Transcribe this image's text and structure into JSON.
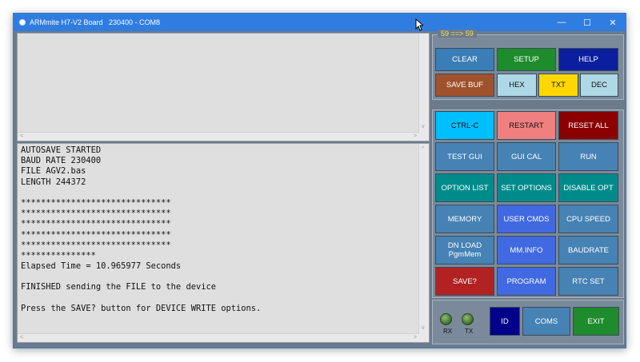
{
  "window": {
    "title": "ARMmite H7-V2 Board   230400 - COM8",
    "controls": {
      "minimize": "—",
      "maximize": "☐",
      "close": "✕"
    }
  },
  "counter": "59 ==> 59",
  "console": {
    "lines": [
      "AUTOSAVE STARTED",
      "BAUD RATE 230400",
      "FILE AGV2.bas",
      "LENGTH 244372",
      "",
      "******************************",
      "******************************",
      "******************************",
      "******************************",
      "******************************",
      "***************",
      "Elapsed Time = 10.965977 Seconds",
      "",
      "FINISHED sending the FILE to the device",
      "",
      "Press the SAVE? button for DEVICE WRITE options."
    ]
  },
  "buttons_top": {
    "clear": "CLEAR",
    "setup": "SETUP",
    "help": "HELP",
    "save_buf": "SAVE BUF",
    "hex": "HEX",
    "txt": "TXT",
    "dec": "DEC"
  },
  "buttons_main": {
    "ctrl_c": "CTRL-C",
    "restart": "RESTART",
    "reset_all": "RESET ALL",
    "test_gui": "TEST GUI",
    "gui_cal": "GUI CAL",
    "run": "RUN",
    "option_list": "OPTION LIST",
    "set_options": "SET OPTIONS",
    "disable_opt": "DISABLE OPT",
    "memory": "MEMORY",
    "user_cmds": "USER CMDS",
    "cpu_speed": "CPU SPEED",
    "dn_load_1": "DN LOAD",
    "dn_load_2": "PgmMem",
    "mm_info": "MM.INFO",
    "baudrate": "BAUDRATE",
    "save_q": "SAVE?",
    "program": "PROGRAM",
    "rtc_set": "RTC SET"
  },
  "buttons_bottom": {
    "id": "ID",
    "coms": "COMS",
    "exit": "EXIT"
  },
  "leds": {
    "rx": "RX",
    "tx": "TX"
  },
  "scroll_arrows": {
    "left": "<",
    "right": ">",
    "down": "v",
    "up": "^"
  },
  "colors": {
    "title_bar": "#2f7de1",
    "clear": "#3a7eb8",
    "setup": "#1e8c2c",
    "help": "#0b1f9e",
    "save_buf": "#a0522d",
    "hex": "#add8e6",
    "txt": "#ffd700",
    "dec": "#add8e6",
    "ctrl_c": "#00bfff",
    "restart": "#f08080",
    "reset_all": "#8b0000",
    "steel": "#4682b4",
    "teal": "#008b8b",
    "royal": "#4169e1",
    "save_q": "#b22222",
    "id": "#00008b",
    "exit": "#1e8c2c"
  }
}
